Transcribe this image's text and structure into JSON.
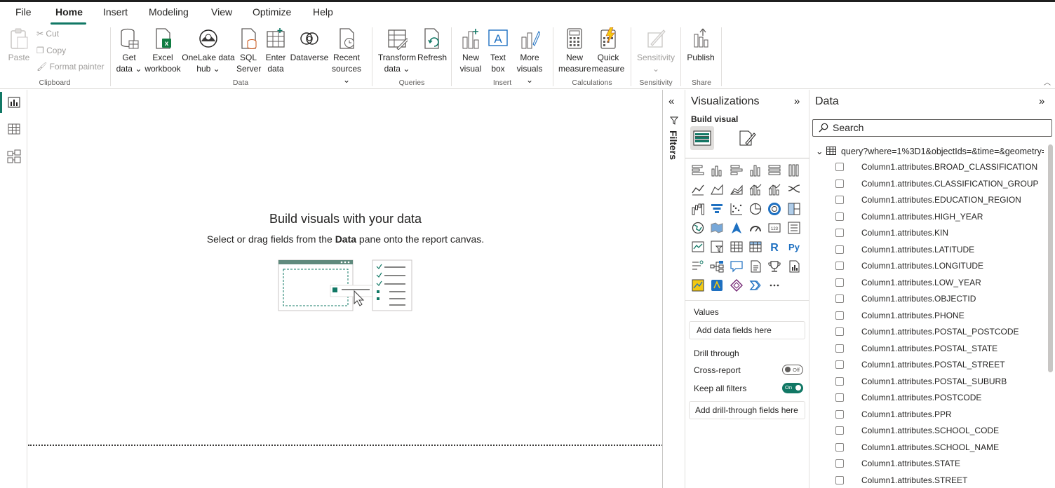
{
  "tabs": [
    "File",
    "Home",
    "Insert",
    "Modeling",
    "View",
    "Optimize",
    "Help"
  ],
  "ribbon": {
    "clipboard": {
      "paste": "Paste",
      "cut": "Cut",
      "copy": "Copy",
      "format_painter": "Format painter",
      "group": "Clipboard"
    },
    "data": {
      "get_data": [
        "Get",
        "data"
      ],
      "excel": [
        "Excel",
        "workbook"
      ],
      "onelake": [
        "OneLake data",
        "hub"
      ],
      "sql": [
        "SQL",
        "Server"
      ],
      "enter": [
        "Enter",
        "data"
      ],
      "dataverse": "Dataverse",
      "recent": [
        "Recent",
        "sources"
      ],
      "group": "Data"
    },
    "queries": {
      "transform": [
        "Transform",
        "data"
      ],
      "refresh": "Refresh",
      "group": "Queries"
    },
    "insert": {
      "new_visual": [
        "New",
        "visual"
      ],
      "text_box": [
        "Text",
        "box"
      ],
      "more_visuals": [
        "More",
        "visuals"
      ],
      "group": "Insert"
    },
    "calculations": {
      "new_measure": [
        "New",
        "measure"
      ],
      "quick_measure": [
        "Quick",
        "measure"
      ],
      "group": "Calculations"
    },
    "sensitivity": {
      "label": "Sensitivity",
      "group": "Sensitivity"
    },
    "share": {
      "publish": "Publish",
      "group": "Share"
    }
  },
  "canvas": {
    "title": "Build visuals with your data",
    "sub_before": "Select or drag fields from the ",
    "sub_bold": "Data",
    "sub_after": " pane onto the report canvas."
  },
  "filters": {
    "label": "Filters"
  },
  "visualizations": {
    "title": "Visualizations",
    "build_visual": "Build visual",
    "values_label": "Values",
    "values_placeholder": "Add data fields here",
    "drill_label": "Drill through",
    "cross_report": "Cross-report",
    "cross_report_state": "Off",
    "keep_filters": "Keep all filters",
    "keep_filters_state": "On",
    "drill_placeholder": "Add drill-through fields here"
  },
  "data_pane": {
    "title": "Data",
    "search_placeholder": "Search",
    "table_name": "query?where=1%3D1&objectIds=&time=&geometry=...",
    "fields": [
      "Column1.attributes.BROAD_CLASSIFICATION",
      "Column1.attributes.CLASSIFICATION_GROUP",
      "Column1.attributes.EDUCATION_REGION",
      "Column1.attributes.HIGH_YEAR",
      "Column1.attributes.KIN",
      "Column1.attributes.LATITUDE",
      "Column1.attributes.LONGITUDE",
      "Column1.attributes.LOW_YEAR",
      "Column1.attributes.OBJECTID",
      "Column1.attributes.PHONE",
      "Column1.attributes.POSTAL_POSTCODE",
      "Column1.attributes.POSTAL_STATE",
      "Column1.attributes.POSTAL_STREET",
      "Column1.attributes.POSTAL_SUBURB",
      "Column1.attributes.POSTCODE",
      "Column1.attributes.PPR",
      "Column1.attributes.SCHOOL_CODE",
      "Column1.attributes.SCHOOL_NAME",
      "Column1.attributes.STATE",
      "Column1.attributes.STREET"
    ]
  },
  "colors": {
    "accent": "#117865",
    "excel": "#107c41",
    "powerbi_yellow": "#f2c811",
    "r_blue": "#1e70c1"
  }
}
